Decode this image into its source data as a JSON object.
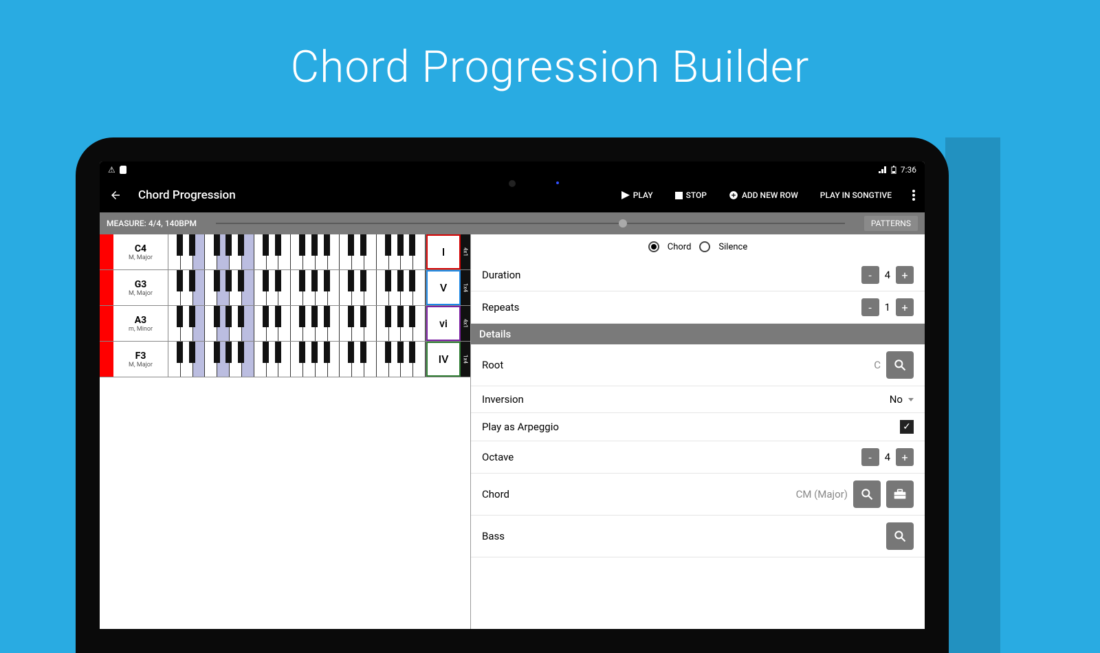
{
  "hero": {
    "title": "Chord Progression Builder"
  },
  "status": {
    "time": "7:36"
  },
  "appbar": {
    "title": "Chord Progression",
    "play": "PLAY",
    "stop": "STOP",
    "add_row": "ADD NEW ROW",
    "play_songtive": "PLAY IN SONGTIVE"
  },
  "subbar": {
    "measure": "MEASURE: 4/4, 140BPM",
    "patterns": "PATTERNS"
  },
  "chords": [
    {
      "note": "C4",
      "mode": "M, Major",
      "roman": "I",
      "color": "#d40000",
      "badge": "4x1"
    },
    {
      "note": "G3",
      "mode": "M, Major",
      "roman": "V",
      "color": "#1e88e5",
      "badge": "1x4"
    },
    {
      "note": "A3",
      "mode": "m, Minor",
      "roman": "vi",
      "color": "#7b1fa2",
      "badge": "4x1"
    },
    {
      "note": "F3",
      "mode": "M, Major",
      "roman": "IV",
      "color": "#2e7d32",
      "badge": "1x4"
    }
  ],
  "radio": {
    "chord": "Chord",
    "silence": "Silence"
  },
  "props": {
    "duration_label": "Duration",
    "duration_value": "4",
    "repeats_label": "Repeats",
    "repeats_value": "1",
    "details_header": "Details",
    "root_label": "Root",
    "root_value": "C",
    "inversion_label": "Inversion",
    "inversion_value": "No",
    "arpeggio_label": "Play as Arpeggio",
    "octave_label": "Octave",
    "octave_value": "4",
    "chord_label": "Chord",
    "chord_value": "CM (Major)",
    "bass_label": "Bass"
  }
}
